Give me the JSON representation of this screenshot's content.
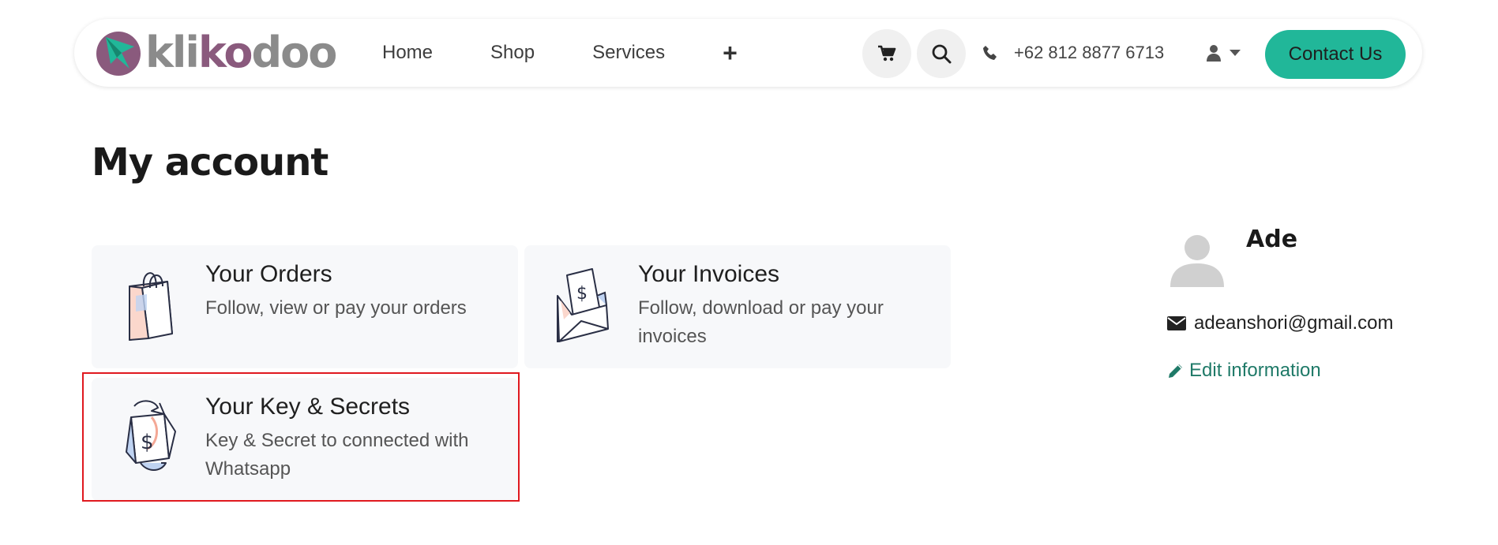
{
  "header": {
    "logo_text_a": "kli",
    "logo_text_b": "ko",
    "logo_text_c": "doo",
    "nav": [
      {
        "label": "Home"
      },
      {
        "label": "Shop"
      },
      {
        "label": "Services"
      }
    ],
    "more_label": "+",
    "phone": "+62 812 8877 6713",
    "contact_label": "Contact Us",
    "icons": {
      "cart": "cart-icon",
      "search": "search-icon",
      "phone": "phone-icon",
      "user": "user-icon",
      "dropdown": "caret-down-icon"
    }
  },
  "page": {
    "title": "My account"
  },
  "cards": [
    {
      "title": "Your Orders",
      "description": "Follow, view or pay your orders",
      "icon": "shopping-bag-icon"
    },
    {
      "title": "Your Invoices",
      "description": "Follow, download or pay your invoices",
      "icon": "invoice-envelope-icon"
    },
    {
      "title": "Your Key & Secrets",
      "description": "Key & Secret to connected with Whatsapp",
      "icon": "key-secret-icon"
    }
  ],
  "profile": {
    "name": "Ade",
    "email": "adeanshori@gmail.com",
    "edit_label": "Edit information"
  },
  "colors": {
    "accent": "#21b799",
    "link": "#1f7a68",
    "highlight_border": "#e0191f",
    "card_bg": "#f7f8fa",
    "logo_purple": "#8a5a7d"
  }
}
